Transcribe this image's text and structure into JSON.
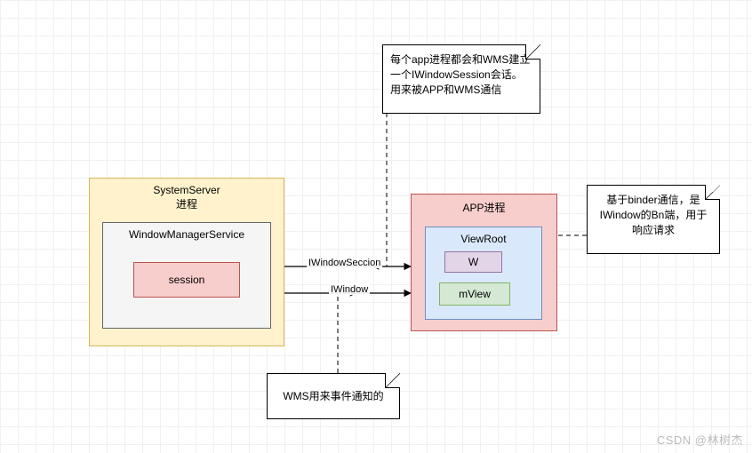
{
  "notes": {
    "top": "每个app进程都会和WMS建立一个IWindowSession会话。用来被APP和WMS通信",
    "right": "基于binder通信，是IWindow的Bn端，用于响应请求",
    "bottom": "WMS用来事件通知的"
  },
  "system_server": {
    "title": "SystemServer\n进程",
    "wms": "WindowManagerService",
    "session": "session"
  },
  "app_process": {
    "title": "APP进程",
    "viewroot": "ViewRoot",
    "w": "W",
    "mview": "mView"
  },
  "edges": {
    "iwindowsession": "IWindowSeccion",
    "iwindow": "IWindow"
  },
  "watermark": "CSDN @林树杰"
}
